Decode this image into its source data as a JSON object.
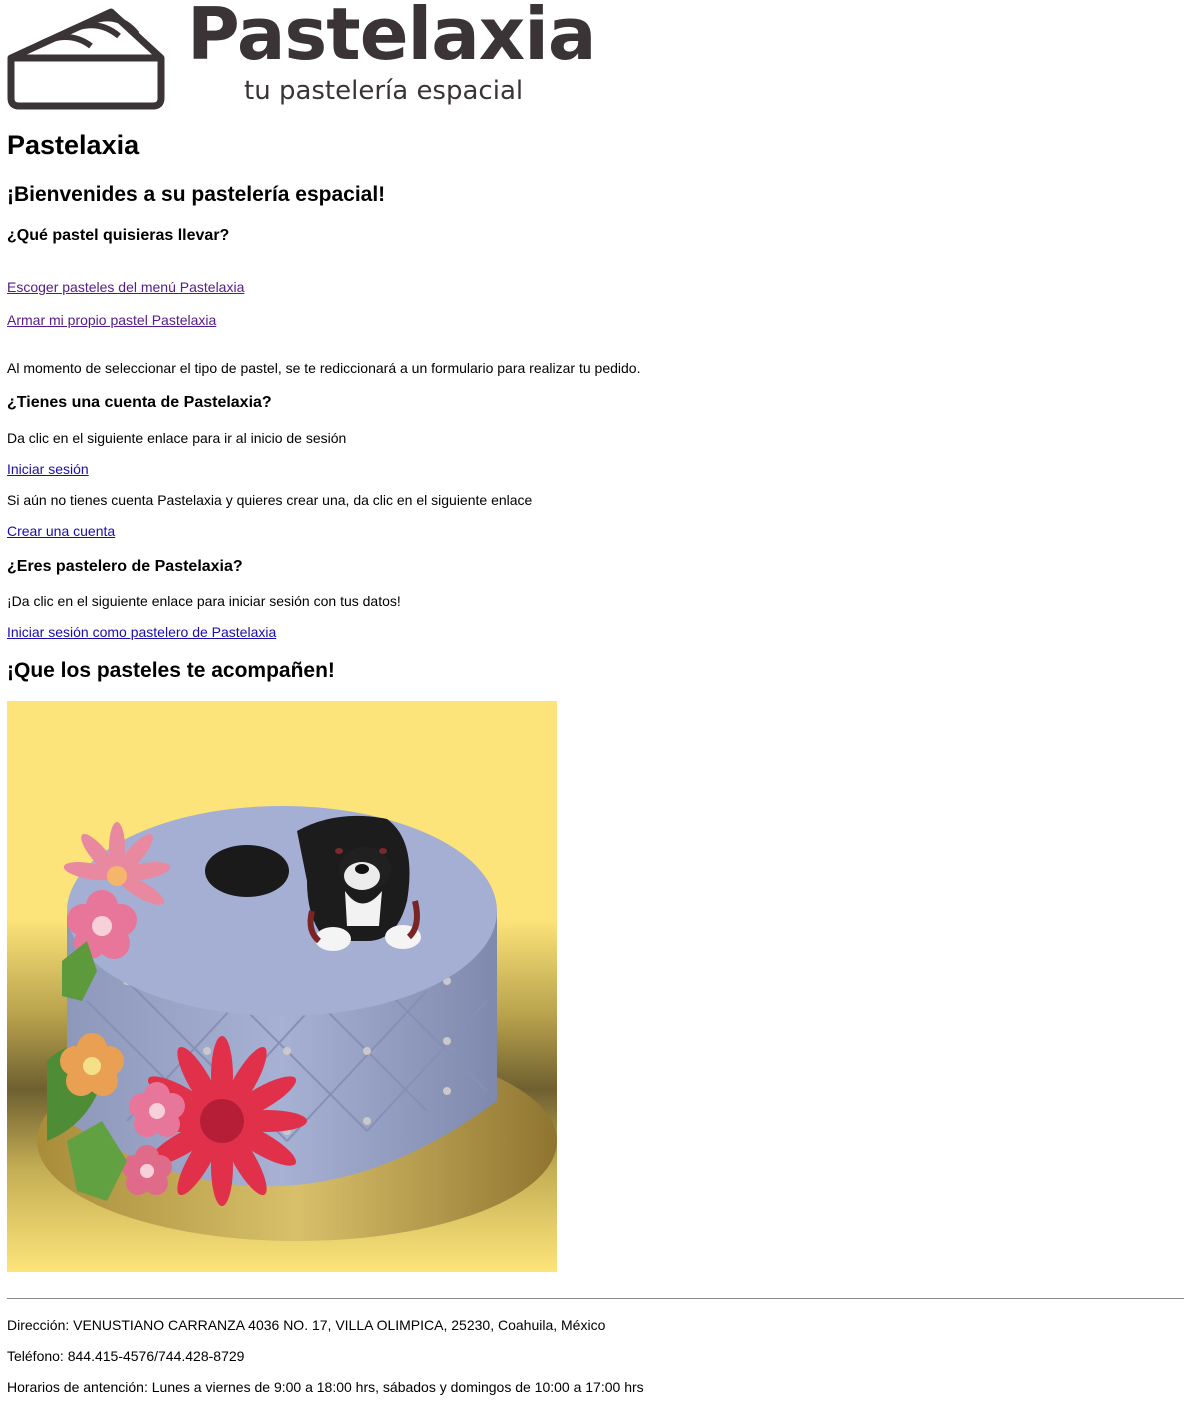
{
  "logo": {
    "wordmark": "Pastelaxia",
    "tagline": "tu pastelería espacial",
    "icon": "cake-slice-icon",
    "color": "#3a3436"
  },
  "page_title": "Pastelaxia",
  "welcome_heading": "¡Bienvenides a su pastelería espacial!",
  "order": {
    "question": "¿Qué pastel quisieras llevar?",
    "menu_link": "Escoger pasteles del menú Pastelaxia",
    "custom_link": "Armar mi propio pastel Pastelaxia",
    "note": "Al momento de seleccionar el tipo de pastel, se te rediccionará a un formulario para realizar tu pedido."
  },
  "account": {
    "question": "¿Tienes una cuenta de Pastelaxia?",
    "login_text": "Da clic en el siguiente enlace para ir al inicio de sesión",
    "login_link": "Iniciar sesión",
    "signup_text": "Si aún no tienes cuenta Pastelaxia y quieres crear una, da clic en el siguiente enlace",
    "signup_link": "Crear una cuenta"
  },
  "baker": {
    "question": "¿Eres pastelero de Pastelaxia?",
    "text": "¡Da clic en el siguiente enlace para iniciar sesión con tus datos!",
    "link": "Iniciar sesión como pastelero de Pastelaxia"
  },
  "closing_heading": "¡Que los pasteles te acompañen!",
  "footer": {
    "address": "Dirección: VENUSTIANO CARRANZA 4036 NO. 17, VILLA OLIMPICA, 25230, Coahuila, México",
    "phone": "Teléfono: 844.415-4576/744.428-8729",
    "hours": "Horarios de antención: Lunes a viernes de 9:00 a 18:00 hrs, sábados y domingos de 10:00 a 17:00 hrs"
  },
  "colors": {
    "link": "#1a0dab",
    "visited_link": "#551a8b",
    "cake_background": "#fde47a",
    "cake_fondant": "#a3aed0"
  }
}
